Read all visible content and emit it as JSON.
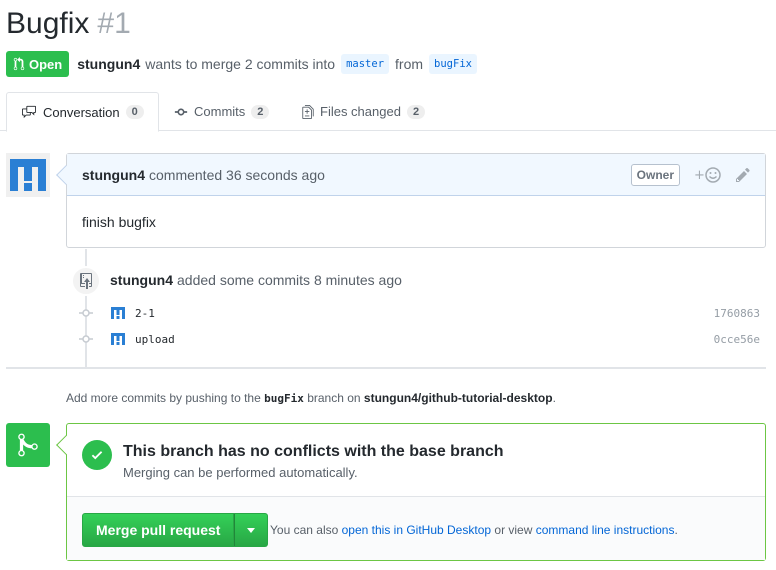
{
  "pr": {
    "title": "Bugfix",
    "number": "#1",
    "state_label": "Open",
    "author": "stungun4",
    "merge_text": "wants to merge 2 commits into",
    "base_branch": "master",
    "from_text": "from",
    "head_branch": "bugFix"
  },
  "tabs": [
    {
      "label": "Conversation",
      "count": "0",
      "icon": "comment-discussion-icon"
    },
    {
      "label": "Commits",
      "count": "2",
      "icon": "git-commit-icon"
    },
    {
      "label": "Files changed",
      "count": "2",
      "icon": "file-diff-icon"
    }
  ],
  "comment": {
    "author": "stungun4",
    "action": "commented 36 seconds ago",
    "badge": "Owner",
    "body": "finish bugfix"
  },
  "event": {
    "author": "stungun4",
    "text": "added some commits 8 minutes ago"
  },
  "commits": [
    {
      "message": "2-1",
      "sha": "1760863"
    },
    {
      "message": "upload",
      "sha": "0cce56e"
    }
  ],
  "push_hint": {
    "prefix": "Add more commits by pushing to the",
    "branch": "bugFix",
    "middle": "branch on",
    "repo": "stungun4/github-tutorial-desktop",
    "suffix": "."
  },
  "merge": {
    "heading": "This branch has no conflicts with the base branch",
    "sub": "Merging can be performed automatically.",
    "button_label": "Merge pull request",
    "alt_prefix": "You can also",
    "alt_link1": "open this in GitHub Desktop",
    "alt_middle": "or view",
    "alt_link2": "command line instructions",
    "alt_suffix": "."
  },
  "colors": {
    "success": "#2cbe4e",
    "link": "#0366d6",
    "avatar": "#2a7fd4"
  }
}
